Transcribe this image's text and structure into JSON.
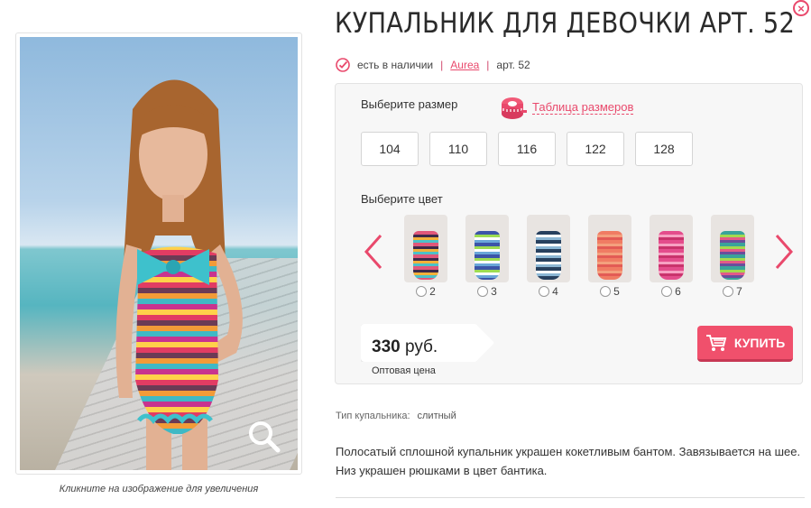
{
  "product": {
    "title": "КУПАЛЬНИК ДЛЯ ДЕВОЧКИ АРТ. 52",
    "image_caption": "Кликните на изображение для увеличения",
    "availability": "есть в наличии",
    "brand": "Aurea",
    "article": "арт. 52"
  },
  "size_select": {
    "label": "Выберите размер",
    "table_link": "Таблица размеров",
    "sizes": [
      "104",
      "110",
      "116",
      "122",
      "128"
    ]
  },
  "color_select": {
    "label": "Выберите цвет",
    "options": [
      {
        "number": "2",
        "color": "#e0577a"
      },
      {
        "number": "3",
        "color": "#3c55a8"
      },
      {
        "number": "4",
        "color": "#27405e"
      },
      {
        "number": "5",
        "color": "#f07c63"
      },
      {
        "number": "6",
        "color": "#e44d8c"
      },
      {
        "number": "7",
        "color": "#3aa39a"
      }
    ]
  },
  "pricing": {
    "price_number": "330",
    "currency": "руб.",
    "note": "Оптовая цена"
  },
  "buy_button": {
    "label": "КУПИТЬ"
  },
  "attributes": {
    "type_label": "Тип купальника:",
    "type_value": "слитный"
  },
  "description": "Полосатый сплошной купальник украшен кокетливым бантом. Завязывается на шее. Низ украшен рюшками в цвет бантика.",
  "colors": {
    "accent": "#e9496c",
    "button": "#f0506c"
  },
  "icons": [
    "check-circle-icon",
    "measuring-tape-icon",
    "chevron-left-icon",
    "chevron-right-icon",
    "cart-icon",
    "magnifier-icon",
    "close-icon"
  ]
}
